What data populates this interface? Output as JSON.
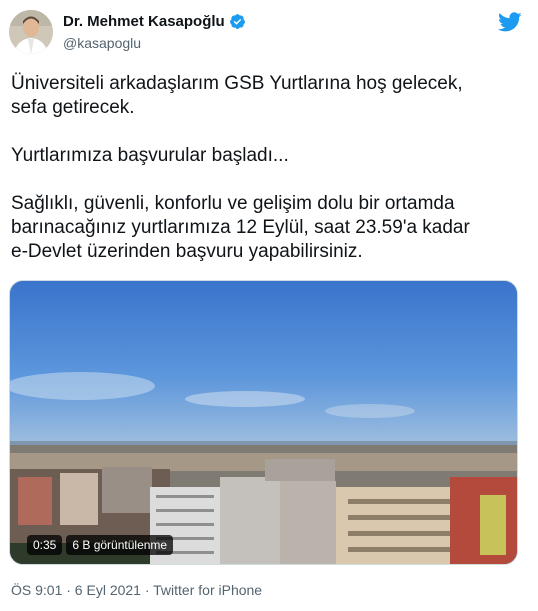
{
  "author": {
    "name": "Dr. Mehmet Kasapoğlu",
    "handle": "@kasapoglu",
    "verified_color": "#1d9bf0"
  },
  "tweet": {
    "paragraphs": [
      "Üniversiteli arkadaşlarım GSB Yurtlarına hoş gelecek,\nsefa getirecek.",
      "Yurtlarımıza başvurular başladı...",
      "Sağlıklı, güvenli, konforlu ve gelişim dolu bir ortamda\nbarınacağınız yurtlarımıza 12 Eylül, saat 23.59'a kadar\ne-Devlet üzerinden başvuru yapabilirsiniz."
    ]
  },
  "media": {
    "type": "video",
    "duration": "0:35",
    "views": "6 B görüntülenme"
  },
  "meta": {
    "line": "ÖS 9:01 · 6 Eyl 2021 · Twitter for iPhone"
  },
  "colors": {
    "twitter_blue": "#1d9bf0",
    "text_primary": "#0f1419",
    "text_secondary": "#536471"
  },
  "icons": [
    "verified-badge-icon",
    "twitter-bird-icon"
  ]
}
